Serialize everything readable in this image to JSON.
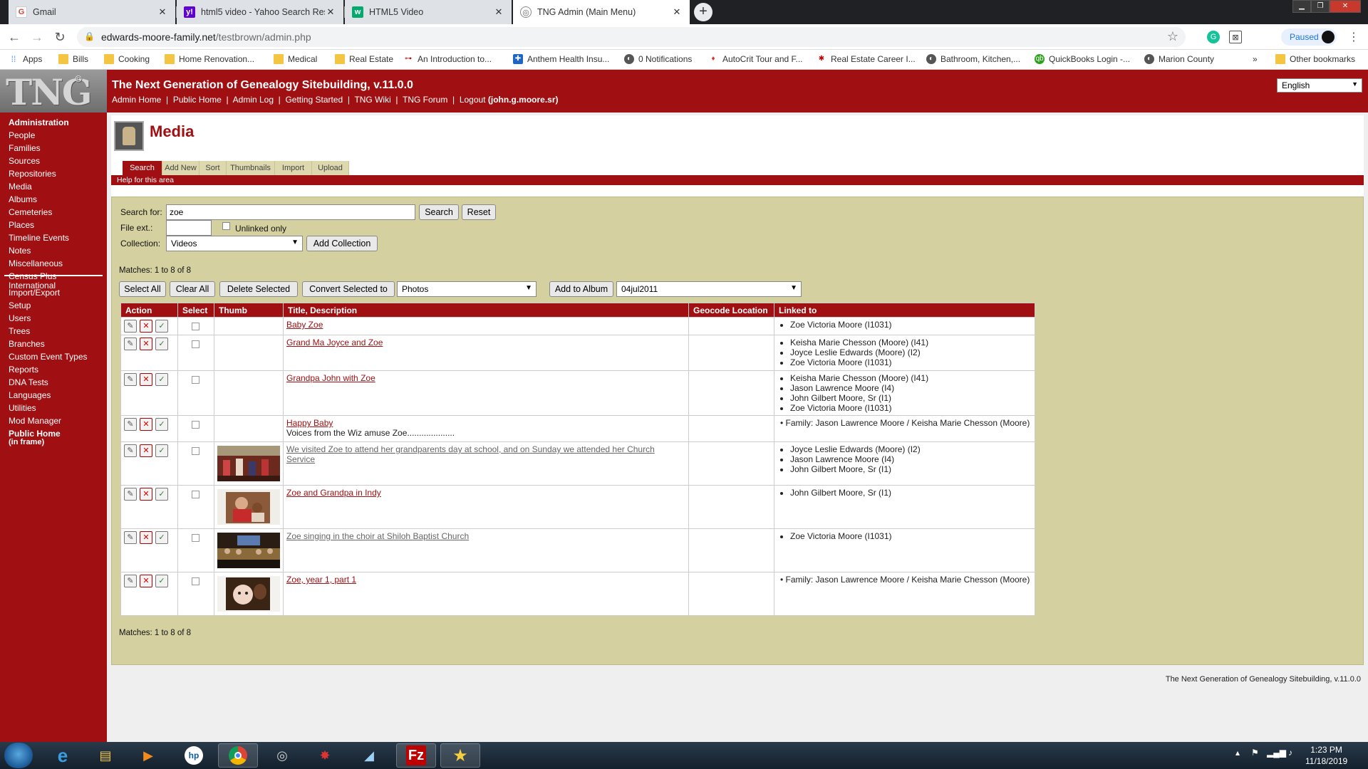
{
  "browser": {
    "tabs": [
      {
        "title": "Gmail",
        "icon": "gmail-icon"
      },
      {
        "title": "html5 video - Yahoo Search Resu",
        "icon": "yahoo-icon"
      },
      {
        "title": "HTML5 Video",
        "icon": "w3-icon"
      },
      {
        "title": "TNG Admin (Main Menu)",
        "icon": "globe-icon"
      }
    ],
    "url_host": "edwards-moore-family.net",
    "url_path": "/testbrown/admin.php",
    "profile_label": "Paused",
    "bookmarks": [
      {
        "label": "Apps"
      },
      {
        "label": "Bills"
      },
      {
        "label": "Cooking"
      },
      {
        "label": "Home Renovation..."
      },
      {
        "label": "Medical"
      },
      {
        "label": "Real Estate"
      },
      {
        "label": "An Introduction to..."
      },
      {
        "label": "Anthem Health Insu..."
      },
      {
        "label": "0 Notifications"
      },
      {
        "label": "AutoCrit Tour and F..."
      },
      {
        "label": "Real Estate Career I..."
      },
      {
        "label": "Bathroom, Kitchen,..."
      },
      {
        "label": "QuickBooks Login -..."
      },
      {
        "label": "Marion County"
      },
      {
        "label": "»"
      },
      {
        "label": "Other bookmarks"
      }
    ]
  },
  "header": {
    "logo": "TNG",
    "site_title": "The Next Generation of Genealogy Sitebuilding, v.11.0.0",
    "links": [
      "Admin Home",
      "Public Home",
      "Admin Log",
      "Getting Started",
      "TNG Wiki",
      "TNG Forum",
      "Logout"
    ],
    "user": "(john.g.moore.sr)",
    "language": "English"
  },
  "nav": {
    "items": [
      {
        "label": "Administration",
        "bold": true
      },
      {
        "label": "People"
      },
      {
        "label": "Families"
      },
      {
        "label": "Sources"
      },
      {
        "label": "Repositories"
      },
      {
        "label": "Media"
      },
      {
        "label": "Albums"
      },
      {
        "label": "Cemeteries"
      },
      {
        "label": "Places"
      },
      {
        "label": "Timeline Events"
      },
      {
        "label": "Notes"
      },
      {
        "label": "Miscellaneous"
      },
      {
        "label": "Census Plus"
      },
      {
        "label": "International"
      },
      {
        "label": "Import/Export"
      },
      {
        "label": "Setup"
      },
      {
        "label": "Users"
      },
      {
        "label": "Trees"
      },
      {
        "label": "Branches"
      },
      {
        "label": "Custom Event Types"
      },
      {
        "label": "Reports"
      },
      {
        "label": "DNA Tests"
      },
      {
        "label": "Languages"
      },
      {
        "label": "Utilities"
      },
      {
        "label": "Mod Manager"
      },
      {
        "label": "Public Home",
        "bold": true
      },
      {
        "label": "(in frame)",
        "bold": true
      }
    ]
  },
  "page": {
    "title": "Media",
    "tabs": [
      "Search",
      "Add New",
      "Sort",
      "Thumbnails",
      "Import",
      "Upload"
    ],
    "help": "Help for this area"
  },
  "search": {
    "search_for_label": "Search for:",
    "search_value": "zoe",
    "search_button": "Search",
    "reset_button": "Reset",
    "fileext_label": "File ext.:",
    "fileext_value": "",
    "unlinked_label": "Unlinked only",
    "collection_label": "Collection:",
    "collection_value": "Videos",
    "add_collection_button": "Add Collection"
  },
  "results": {
    "matches_text": "Matches: 1 to 8 of 8",
    "select_all": "Select All",
    "clear_all": "Clear All",
    "delete_selected": "Delete Selected",
    "convert_selected": "Convert Selected to",
    "convert_target": "Photos",
    "add_to_album": "Add to Album",
    "album_value": "04jul2011",
    "columns": [
      "Action",
      "Select",
      "Thumb",
      "Title, Description",
      "Geocode Location",
      "Linked to"
    ],
    "rows": [
      {
        "title": "Baby Zoe",
        "description": "",
        "thumb": "none",
        "visited": false,
        "linked": [
          "Zoe Victoria Moore (I1031)"
        ]
      },
      {
        "title": "Grand Ma Joyce and Zoe",
        "description": "",
        "thumb": "none",
        "visited": false,
        "linked": [
          "Keisha Marie Chesson (Moore) (I41)",
          "Joyce Leslie Edwards (Moore) (I2)",
          "Zoe Victoria Moore (I1031)"
        ]
      },
      {
        "title": "Grandpa John with Zoe",
        "description": "",
        "thumb": "none",
        "visited": false,
        "linked": [
          "Keisha Marie Chesson (Moore) (I41)",
          "Jason Lawrence Moore (I4)",
          "John Gilbert Moore, Sr (I1)",
          "Zoe Victoria Moore (I1031)"
        ]
      },
      {
        "title": "Happy Baby",
        "description": "Voices from the Wiz amuse Zoe....................",
        "thumb": "none",
        "visited": false,
        "linked": [
          "Family: Jason Lawrence Moore / Keisha Marie Chesson (Moore)"
        ]
      },
      {
        "title": "We visited Zoe to attend her grandparents day at school, and on Sunday we attended her Church Service",
        "description": "",
        "thumb": "school",
        "visited": true,
        "linked": [
          "Joyce Leslie Edwards (Moore) (I2)",
          "Jason Lawrence Moore (I4)",
          "John Gilbert Moore, Sr (I1)"
        ]
      },
      {
        "title": "Zoe and Grandpa in Indy",
        "description": "",
        "thumb": "grandpa",
        "visited": false,
        "linked": [
          "John Gilbert Moore, Sr (I1)"
        ]
      },
      {
        "title": "Zoe singing in the choir at Shiloh Baptist Church",
        "description": "",
        "thumb": "choir",
        "visited": true,
        "linked": [
          "Zoe Victoria Moore (I1031)"
        ]
      },
      {
        "title": "Zoe, year 1, part 1",
        "description": "",
        "thumb": "baby",
        "visited": false,
        "linked": [
          "Family: Jason Lawrence Moore / Keisha Marie Chesson (Moore)"
        ]
      }
    ]
  },
  "footer": "The Next Generation of Genealogy Sitebuilding, v.11.0.0",
  "taskbar": {
    "time": "1:23 PM",
    "date": "11/18/2019"
  },
  "colors": {
    "tng_red": "#a01013",
    "panel_bg": "#d4d09f"
  }
}
